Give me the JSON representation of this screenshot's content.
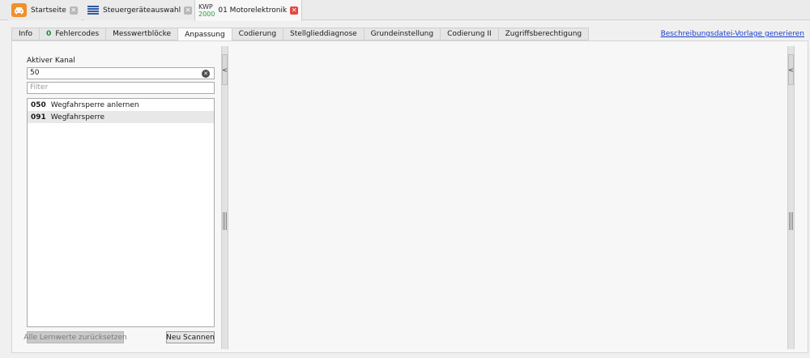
{
  "doc_tabs": [
    {
      "label": "Startseite",
      "icon": "car-icon"
    },
    {
      "label": "Steuergeräteauswahl",
      "icon": "list-icon"
    },
    {
      "label": "01 Motorelektronik",
      "brand_top": "KWP",
      "brand_bottom": "2000"
    }
  ],
  "sub_tabs": [
    {
      "label": "Info"
    },
    {
      "count": "0",
      "label": "Fehlercodes"
    },
    {
      "label": "Messwertblöcke"
    },
    {
      "label": "Anpassung",
      "active": true
    },
    {
      "label": "Codierung"
    },
    {
      "label": "Stellglieddiagnose"
    },
    {
      "label": "Grundeinstellung"
    },
    {
      "label": "Codierung II"
    },
    {
      "label": "Zugriffsberechtigung"
    }
  ],
  "generate_link": "Beschreibungsdatei-Vorlage generieren",
  "panel": {
    "title": "Aktiver Kanal",
    "channel_value": "50",
    "filter_placeholder": "Filter",
    "items": [
      {
        "num": "050",
        "label": "Wegfahrsperre anlernen"
      },
      {
        "num": "091",
        "label": "Wegfahrsperre"
      }
    ],
    "reset_button": "Alle Lernwerte zurücksetzen",
    "scan_button": "Neu Scannen"
  },
  "splitter_arrow": "<",
  "colors": {
    "accent_orange": "#f2902a",
    "close_red": "#e5473f",
    "count_green": "#1c8a2c",
    "link_blue": "#1a3fc8"
  }
}
